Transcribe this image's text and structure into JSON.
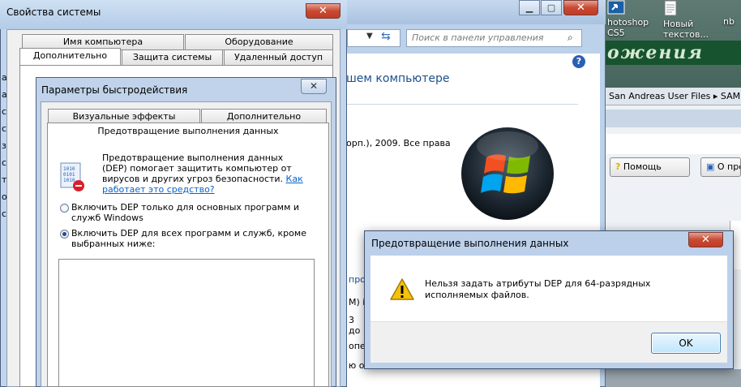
{
  "desktop": {
    "icons": [
      {
        "label_lines": [
          "hotoshop",
          "CS5"
        ]
      },
      {
        "label_lines": [
          "Новый",
          "текстов..."
        ]
      },
      {
        "label_lines": [
          "nb"
        ]
      }
    ],
    "banner_text": "ожения"
  },
  "sa_window": {
    "breadcrumb": "San Andreas User Files  ▸  SAM",
    "help_button": "Помощь",
    "about_button": "О прогр"
  },
  "control_panel": {
    "search_placeholder": "Поиск в панели управления",
    "heading_fragment": "шем компьютере",
    "copyright_fragment": "орп.), 2009. Все права",
    "left_fragments": [
      "про",
      "M) i",
      "3 до",
      "опер",
      "ю о"
    ],
    "side_letters": [
      "а",
      "а",
      "с",
      "с",
      "з",
      "с",
      "т",
      "о",
      "с"
    ]
  },
  "system_properties": {
    "title": "Свойства системы",
    "tabs_row1": [
      "Имя компьютера",
      "Оборудование"
    ],
    "tabs_row2": [
      "Дополнительно",
      "Защита системы",
      "Удаленный доступ"
    ]
  },
  "performance": {
    "title": "Параметры быстродействия",
    "tabs": [
      "Визуальные эффекты",
      "Дополнительно"
    ],
    "active_tab": "Предотвращение выполнения данных",
    "description": "Предотвращение выполнения данных (DEP) помогает защитить компьютер от вирусов и других угроз безопасности.",
    "link": "Как работает это средство?",
    "option1": "Включить DEP только для основных программ и служб Windows",
    "option2": "Включить DEP для всех программ и служб, кроме выбранных ниже:"
  },
  "alert": {
    "title": "Предотвращение выполнения данных",
    "message": "Нельзя задать атрибуты DEP для 64-разрядных исполняемых файлов.",
    "ok": "OK"
  },
  "colors": {
    "link": "#0b62c9",
    "heading": "#1e4f8c",
    "close": "#c33b23"
  }
}
